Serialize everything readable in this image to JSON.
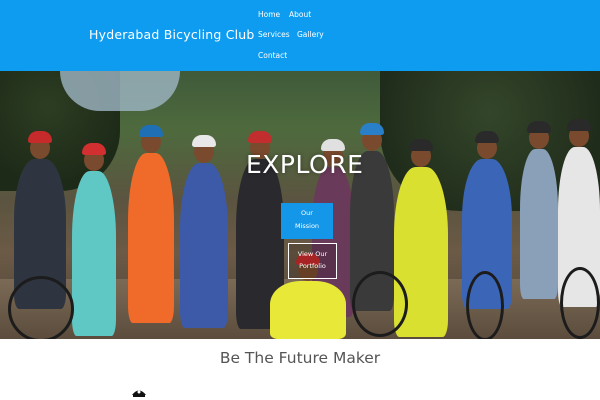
{
  "header": {
    "site_title": "Hyderabad Bicycling Club",
    "nav": {
      "home": "Home",
      "about": "About",
      "services": "Services",
      "gallery": "Gallery",
      "contact": "Contact"
    },
    "background_color": "#0e9cf0"
  },
  "hero": {
    "title": "EXPLORE",
    "mission_button_line1": "Our",
    "mission_button_line2": "Mission",
    "view_button_line1": "View Our",
    "view_button_line2": "Portfolio",
    "image_semantic": "group-photo-of-cyclists"
  },
  "content": {
    "tagline": "Be The Future Maker",
    "icon": "cyclist-helmet-icon"
  }
}
